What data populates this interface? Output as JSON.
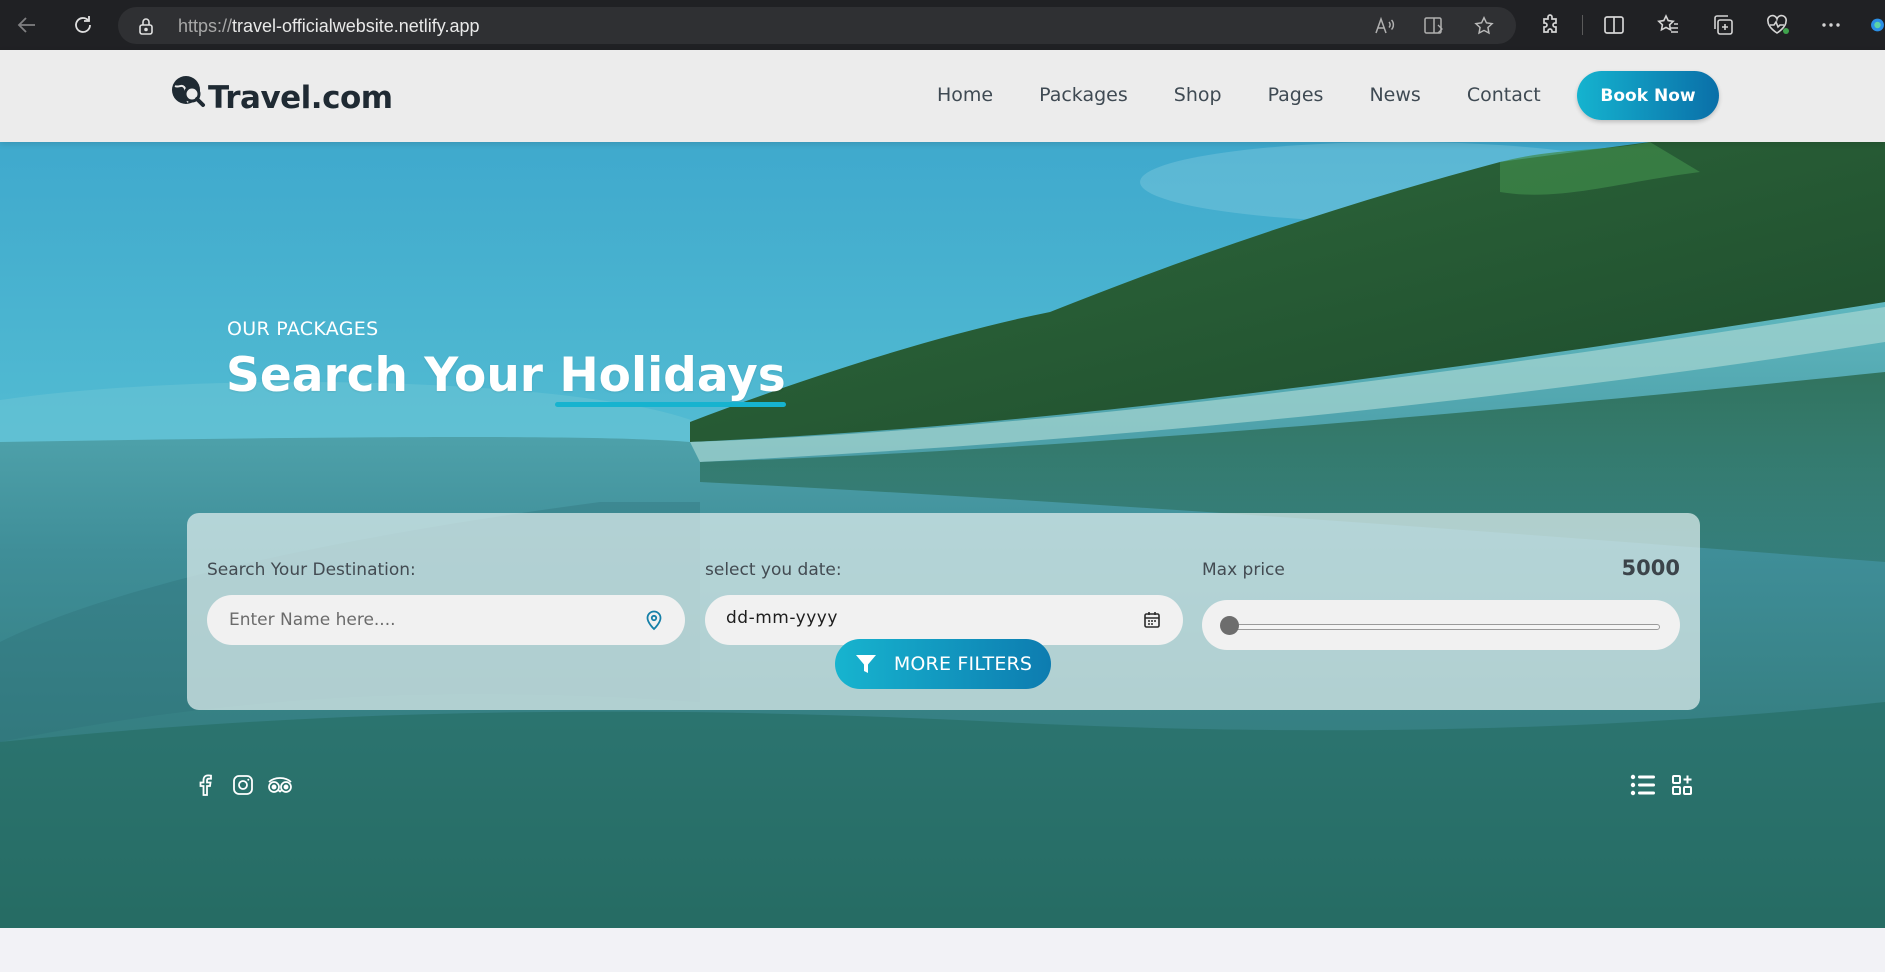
{
  "browser": {
    "url_protocol": "https://",
    "url_host": "travel-officialwebsite.netlify.app"
  },
  "header": {
    "logo_text": "Travel.com",
    "nav": [
      "Home",
      "Packages",
      "Shop",
      "Pages",
      "News",
      "Contact"
    ],
    "cta_label": "Book Now"
  },
  "hero": {
    "subtitle": "OUR PACKAGES",
    "title_plain": "Search Your ",
    "title_highlight": "Holidays"
  },
  "search": {
    "destination_label": "Search Your Destination:",
    "destination_placeholder": "Enter Name here....",
    "date_label": "select you date:",
    "date_value": "dd-mm-yyyy",
    "price_label": "Max price",
    "price_value": "5000",
    "price_slider_fraction": 0,
    "more_filters_label": "MORE FILTERS"
  },
  "icons": {
    "social": [
      "facebook-icon",
      "instagram-icon",
      "tripadvisor-icon"
    ],
    "views": [
      "list-view-icon",
      "grid-view-icon"
    ]
  },
  "colors": {
    "accent_start": "#15b3cf",
    "accent_end": "#0a6fa8",
    "header_bg": "#ececec",
    "logo_text": "#1f2a33"
  }
}
